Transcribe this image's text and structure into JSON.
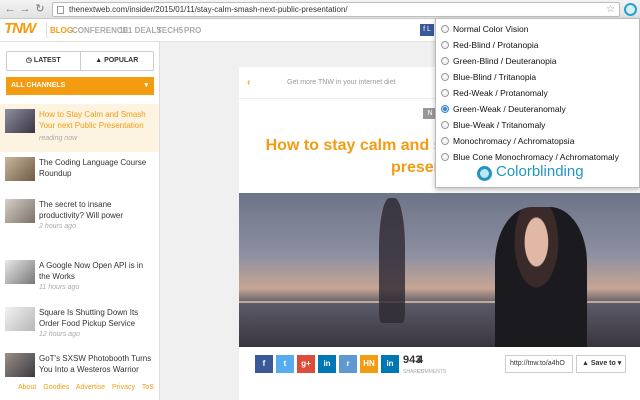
{
  "browser": {
    "url": "thenextweb.com/insider/2015/01/11/stay-calm-smash-next-public-presentation/"
  },
  "site": {
    "logo": "TNW",
    "nav": [
      "BLOG",
      "CONFERENCE",
      "101 DEALS",
      "TECH5",
      "PRO"
    ],
    "facebook_badge": "f L"
  },
  "sidebar": {
    "tabs": [
      "LATEST",
      "POPULAR"
    ],
    "channels": "ALL CHANNELS",
    "items": [
      {
        "title": "How to Stay Calm and Smash Your next Public Presentation",
        "meta": "reading now"
      },
      {
        "title": "The Coding Language Course Roundup",
        "meta": ""
      },
      {
        "title": "The secret to insane productivity? Will power",
        "meta": "2 hours ago"
      },
      {
        "title": "A Google Now Open API is in the Works",
        "meta": "11 hours ago"
      },
      {
        "title": "Square Is Shutting Down Its Order Food Pickup Service",
        "meta": "12 hours ago"
      },
      {
        "title": "GoT's SXSW Photobooth Turns You Into a Westeros Warrior",
        "meta": ""
      }
    ],
    "footer": [
      "About",
      "Goodies",
      "Advertise",
      "Privacy",
      "ToS"
    ]
  },
  "article": {
    "promo": "Get more TNW in your internet diet",
    "badge": "N",
    "headline": "How to stay calm and smash your next public presentation",
    "share_buttons": [
      "f",
      "t",
      "g+",
      "in",
      "r",
      "HN",
      "in"
    ],
    "shares_count": "943",
    "shares_label": "SHARES",
    "comments_count": "4",
    "comments_label": "COMMENTS",
    "short_url": "http://tnw.to/a4hO",
    "save_label": "Save to"
  },
  "colorblinding": {
    "options": [
      "Normal Color Vision",
      "Red-Blind / Protanopia",
      "Green-Blind / Deuteranopia",
      "Blue-Blind / Tritanopia",
      "Red-Weak / Protanomaly",
      "Green-Weak / Deuteranomaly",
      "Blue-Weak / Tritanomaly",
      "Monochromacy / Achromatopsia",
      "Blue Cone Monochromacy / Achromatomaly"
    ],
    "selected_index": 5,
    "brand": "Colorblinding"
  },
  "colors": {
    "accent": "#f39c12",
    "brand_blue": "#2196c4"
  }
}
